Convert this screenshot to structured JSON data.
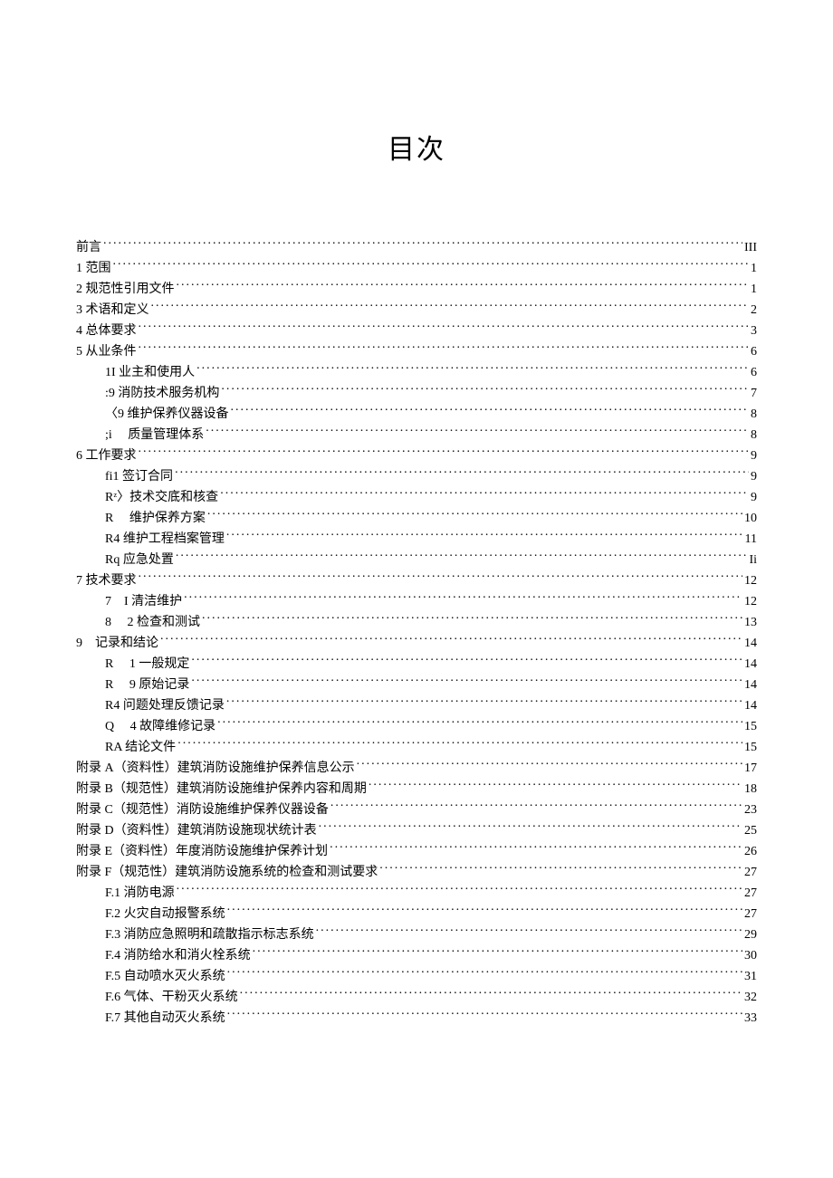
{
  "title": "目次",
  "toc": [
    {
      "indent": 0,
      "label": "前言",
      "page": "III"
    },
    {
      "indent": 0,
      "label": "1 范围",
      "page": "1"
    },
    {
      "indent": 0,
      "label": "2 规范性引用文件",
      "page": "1"
    },
    {
      "indent": 0,
      "label": "3 术语和定义",
      "page": "2"
    },
    {
      "indent": 0,
      "label": "4 总体要求",
      "page": "3"
    },
    {
      "indent": 0,
      "label": "5 从业条件",
      "page": "6"
    },
    {
      "indent": 1,
      "label": "1I 业主和使用人",
      "page": "6"
    },
    {
      "indent": 1,
      "label": ":9 消防技术服务机构",
      "page": "7"
    },
    {
      "indent": 1,
      "label": "〈9 维护保养仪器设备",
      "page": "8"
    },
    {
      "indent": 1,
      "label": ";i  质量管理体系",
      "page": "8"
    },
    {
      "indent": 0,
      "label": "6 工作要求",
      "page": "9"
    },
    {
      "indent": 1,
      "label": "fi1 签订合同",
      "page": "9"
    },
    {
      "indent": 1,
      "label": "Rᶻ〉技术交底和核查",
      "page": "9"
    },
    {
      "indent": 1,
      "label": "R  维护保养方案",
      "page": "10"
    },
    {
      "indent": 1,
      "label": "R4 维护工程档案管理",
      "page": "11"
    },
    {
      "indent": 1,
      "label": "Rq 应急处置",
      "page": "Ii"
    },
    {
      "indent": 0,
      "label": "7 技术要求",
      "page": "12"
    },
    {
      "indent": 1,
      "label": "7 I 清洁维护",
      "page": "12"
    },
    {
      "indent": 1,
      "label": "8  2 检查和测试",
      "page": "13"
    },
    {
      "indent": 0,
      "label": "9 记录和结论",
      "page": "14"
    },
    {
      "indent": 1,
      "label": "R  1 一般规定",
      "page": "14"
    },
    {
      "indent": 1,
      "label": "R  9 原始记录",
      "page": "14"
    },
    {
      "indent": 1,
      "label": "R4 问题处理反馈记录",
      "page": "14"
    },
    {
      "indent": 1,
      "label": "Q  4 故障维修记录",
      "page": "15"
    },
    {
      "indent": 1,
      "label": "RA 结论文件",
      "page": "15"
    },
    {
      "indent": 0,
      "label": "附录 A（资料性）建筑消防设施维护保养信息公示",
      "page": "17"
    },
    {
      "indent": 0,
      "label": "附录 B（规范性）建筑消防设施维护保养内容和周期",
      "page": "18"
    },
    {
      "indent": 0,
      "label": "附录 C（规范性）消防设施维护保养仪器设备",
      "page": "23"
    },
    {
      "indent": 0,
      "label": "附录 D（资料性）建筑消防设施现状统计表",
      "page": "25"
    },
    {
      "indent": 0,
      "label": "附录 E（资料性）年度消防设施维护保养计划",
      "page": "26"
    },
    {
      "indent": 0,
      "label": "附录 F（规范性）建筑消防设施系统的检查和测试要求",
      "page": "27"
    },
    {
      "indent": 1,
      "label": "F.1 消防电源",
      "page": "27"
    },
    {
      "indent": 1,
      "label": "F.2 火灾自动报警系统",
      "page": "27"
    },
    {
      "indent": 1,
      "label": "F.3 消防应急照明和疏散指示标志系统",
      "page": "29"
    },
    {
      "indent": 1,
      "label": "F.4 消防给水和消火栓系统",
      "page": "30"
    },
    {
      "indent": 1,
      "label": "F.5 自动喷水灭火系统",
      "page": "31"
    },
    {
      "indent": 1,
      "label": "F.6 气体、干粉灭火系统",
      "page": "32"
    },
    {
      "indent": 1,
      "label": "F.7 其他自动灭火系统",
      "page": "33"
    }
  ]
}
